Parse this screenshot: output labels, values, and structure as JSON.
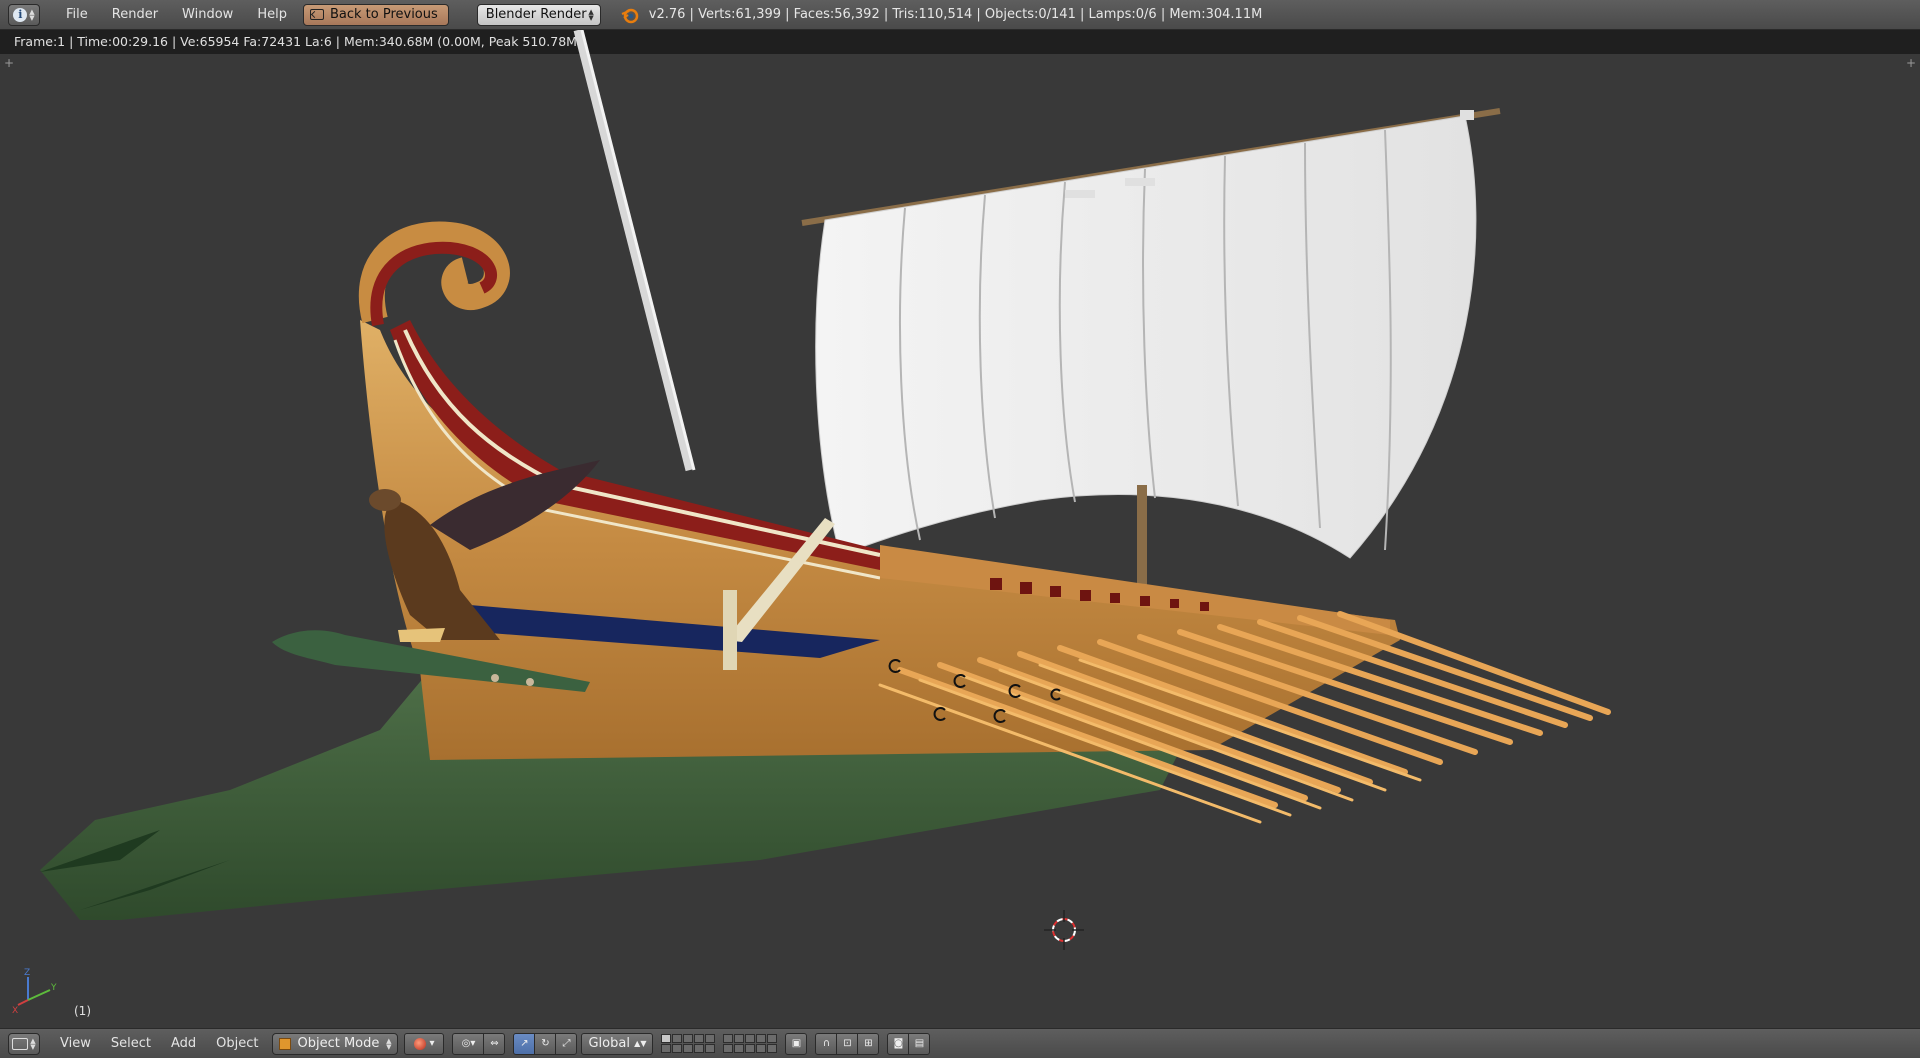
{
  "top_header": {
    "menu": [
      "File",
      "Render",
      "Window",
      "Help"
    ],
    "back_button": "Back to Previous",
    "render_engine": "Blender Render",
    "stats": "v2.76 | Verts:61,399 | Faces:56,392 | Tris:110,514 | Objects:0/141 | Lamps:0/6 | Mem:304.11M"
  },
  "viewport": {
    "render_info": "Frame:1 | Time:00:29.16 | Ve:65954 Fa:72431 La:6 | Mem:340.68M (0.00M, Peak 510.78M)",
    "frame_label": "(1)",
    "axis_labels": {
      "x": "X",
      "y": "Y",
      "z": "Z"
    }
  },
  "bottom_header": {
    "menu": [
      "View",
      "Select",
      "Add",
      "Object"
    ],
    "mode": "Object Mode",
    "orientation": "Global"
  },
  "colors": {
    "header_bg": "#4a4a4a",
    "viewport_bg": "#393939",
    "info_strip_bg": "#1f1f1f",
    "back_button": "#b3856a",
    "active_button": "#5a7fbb"
  },
  "icons": [
    "info-icon",
    "blender-logo-icon",
    "back-icon",
    "3d-view-icon",
    "object-mode-icon",
    "viewport-shading-icon",
    "pivot-icon",
    "manipulator-icon",
    "translate-icon",
    "rotate-icon",
    "scale-icon",
    "layer-icon",
    "lock-icon",
    "render-icon",
    "camera-icon",
    "3d-cursor-icon"
  ]
}
